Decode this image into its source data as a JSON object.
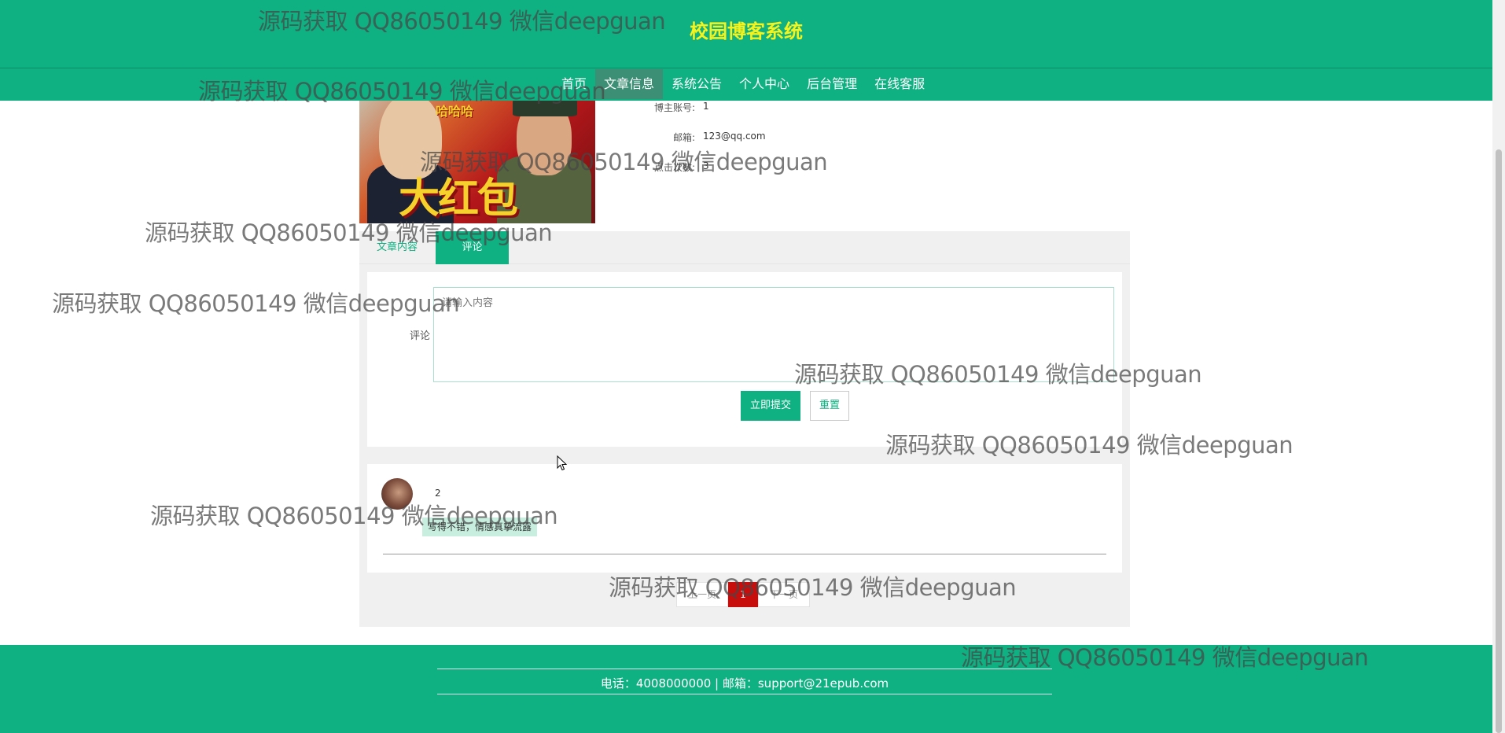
{
  "header": {
    "site_title": "校园博客系统",
    "nav": [
      "首页",
      "文章信息",
      "系统公告",
      "个人中心",
      "后台管理",
      "在线客服"
    ],
    "active_nav": "文章信息"
  },
  "article": {
    "cover_text": "大红包",
    "cover_small_text": "哈哈哈",
    "info": [
      {
        "label": "博主账号:",
        "value": "1"
      },
      {
        "label": "邮箱:",
        "value": "123@qq.com"
      },
      {
        "label": "点击次数:",
        "value": "3"
      }
    ]
  },
  "tabs": {
    "content": "文章内容",
    "comment": "评论"
  },
  "comment_form": {
    "label": "评论",
    "placeholder": "请输入内容",
    "submit": "立即提交",
    "reset": "重置"
  },
  "comments": [
    {
      "user": "2",
      "text": "写得不错，情感真挚流露"
    }
  ],
  "pagination": {
    "prev": "上一页",
    "current": "1",
    "next": "下一页"
  },
  "footer": {
    "contact": "电话：4008000000 | 邮箱：support@21epub.com"
  },
  "watermark": {
    "text": "源码获取 QQ86050149 微信deepguan"
  },
  "colors": {
    "brand": "#0fb081",
    "title": "#f6f31c",
    "page_active": "#c80d0d"
  }
}
